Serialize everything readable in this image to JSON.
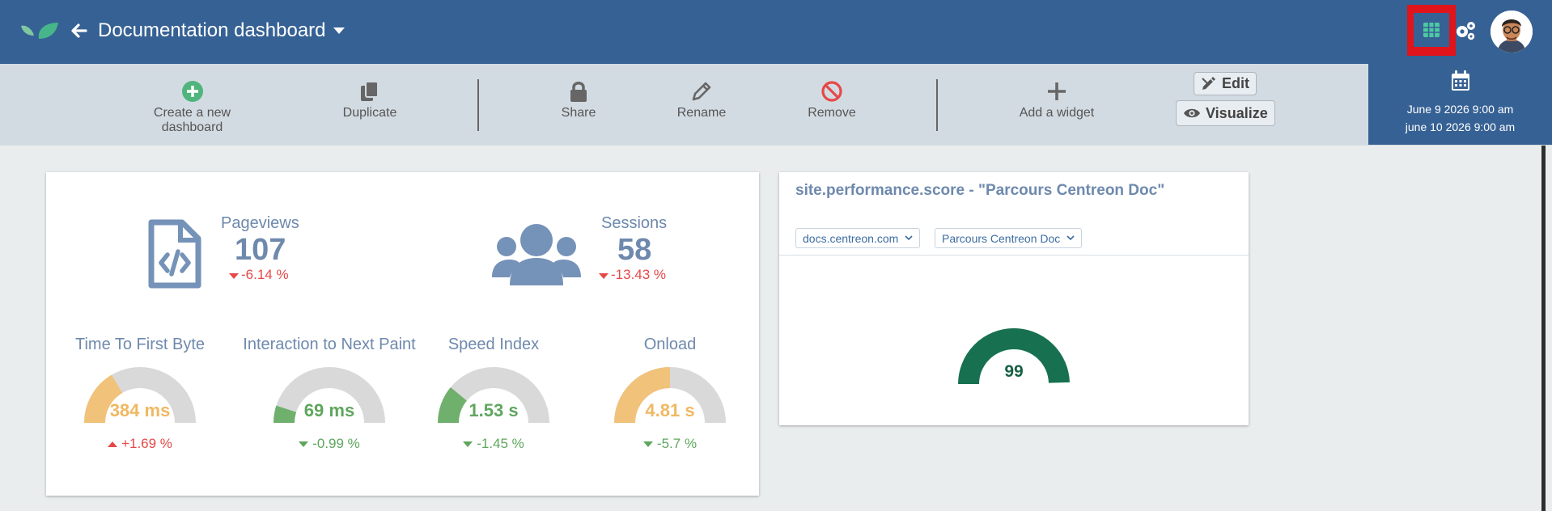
{
  "header": {
    "title": "Documentation dashboard",
    "accent": "#366194",
    "highlight": "#e0141b"
  },
  "toolbar": {
    "create": "Create a new dashboard",
    "duplicate": "Duplicate",
    "share": "Share",
    "rename": "Rename",
    "remove": "Remove",
    "add_widget": "Add a widget",
    "edit": "Edit",
    "visualize": "Visualize"
  },
  "date_range": {
    "start": "June 9 2026 9:00 am",
    "end": "june 10 2026 9:00 am"
  },
  "stats": {
    "pageviews": {
      "label": "Pageviews",
      "value": "107",
      "delta": "-6.14 %"
    },
    "sessions": {
      "label": "Sessions",
      "value": "58",
      "delta": "-13.43 %"
    }
  },
  "metrics": [
    {
      "title": "Time To First Byte",
      "value": "384 ms",
      "delta": "+1.69 %",
      "fraction": 0.33,
      "color": "#f0c27a",
      "trend": "up"
    },
    {
      "title": "Interaction to Next Paint",
      "value": "69 ms",
      "delta": "-0.99 %",
      "fraction": 0.1,
      "color": "#6fb06c",
      "trend": "down"
    },
    {
      "title": "Speed Index",
      "value": "1.53 s",
      "delta": "-1.45 %",
      "fraction": 0.22,
      "color": "#6fb06c",
      "trend": "down"
    },
    {
      "title": "Onload",
      "value": "4.81 s",
      "delta": "-5.7 %",
      "fraction": 0.5,
      "color": "#f0c27a",
      "trend": "down"
    }
  ],
  "widget": {
    "title": "site.performance.score - \"Parcours Centreon Doc\"",
    "site_select": "docs.centreon.com",
    "journey_select": "Parcours Centreon Doc",
    "score": "99",
    "score_fraction": 0.99,
    "score_color": "#177151"
  },
  "icons": {
    "logo": "leaf-logo-icon",
    "back": "arrow-left-icon",
    "grid": "grid-icon",
    "settings": "gears-icon",
    "calendar": "calendar-icon"
  }
}
